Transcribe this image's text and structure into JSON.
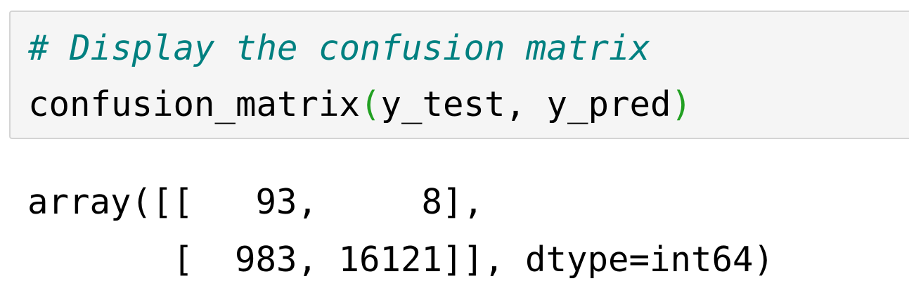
{
  "input_cell": {
    "comment": "# Display the confusion matrix",
    "call": {
      "function": "confusion_matrix",
      "open_paren": "(",
      "args": "y_test, y_pred",
      "close_paren": ")"
    }
  },
  "output_cell": {
    "lines": [
      "array([[   93,     8],",
      "       [  983, 16121]], dtype=int64)"
    ]
  },
  "colors": {
    "comment": "#008080",
    "paren": "#22a022",
    "cell_background": "#f5f5f5",
    "cell_border": "#d4d4d4"
  }
}
